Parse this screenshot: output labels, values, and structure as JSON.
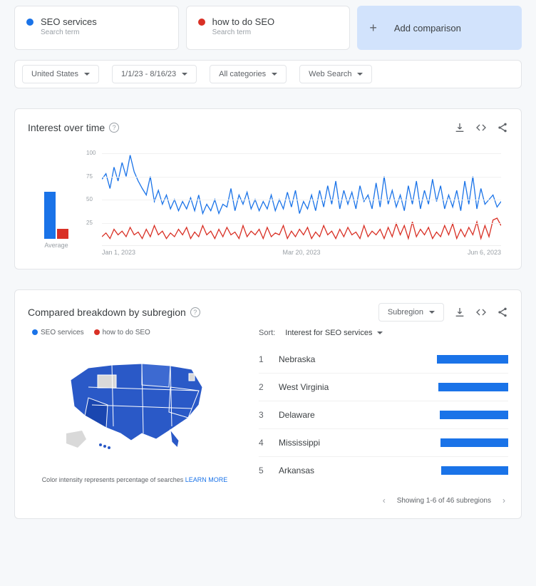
{
  "terms": [
    {
      "name": "SEO services",
      "subtitle": "Search term",
      "color": "#1a73e8"
    },
    {
      "name": "how to do SEO",
      "subtitle": "Search term",
      "color": "#d93025"
    }
  ],
  "add_comparison_label": "Add comparison",
  "filters": {
    "geo": "United States",
    "date": "1/1/23 - 8/16/23",
    "category": "All categories",
    "search_type": "Web Search"
  },
  "interest_card": {
    "title": "Interest over time",
    "avg_label": "Average",
    "x_labels": [
      "Jan 1, 2023",
      "Mar 20, 2023",
      "Jun 6, 2023"
    ]
  },
  "chart_data": {
    "type": "line",
    "title": "Interest over time",
    "xlabel": "",
    "ylabel": "",
    "ylim": [
      0,
      100
    ],
    "yticks": [
      25,
      50,
      75,
      100
    ],
    "x_labels": [
      "Jan 1, 2023",
      "Mar 20, 2023",
      "Jun 6, 2023"
    ],
    "series": [
      {
        "name": "SEO services",
        "color": "#1a73e8",
        "avg": 55,
        "values": [
          72,
          78,
          62,
          85,
          70,
          90,
          75,
          98,
          80,
          70,
          62,
          55,
          75,
          48,
          60,
          45,
          55,
          40,
          50,
          38,
          48,
          40,
          52,
          38,
          55,
          35,
          45,
          38,
          50,
          35,
          45,
          42,
          62,
          38,
          55,
          45,
          58,
          40,
          50,
          38,
          48,
          40,
          55,
          38,
          50,
          40,
          58,
          42,
          60,
          35,
          48,
          40,
          55,
          38,
          60,
          42,
          65,
          45,
          70,
          40,
          60,
          45,
          58,
          40,
          65,
          48,
          55,
          40,
          68,
          42,
          75,
          45,
          60,
          42,
          55,
          38,
          65,
          45,
          70,
          40,
          60,
          45,
          72,
          48,
          65,
          40,
          55,
          42,
          60,
          38,
          70,
          45,
          75,
          40,
          62,
          45,
          50,
          55,
          42,
          48
        ]
      },
      {
        "name": "how to do SEO",
        "color": "#d93025",
        "avg": 12,
        "values": [
          10,
          14,
          8,
          18,
          12,
          16,
          10,
          20,
          12,
          15,
          8,
          18,
          10,
          22,
          12,
          16,
          8,
          14,
          10,
          18,
          12,
          20,
          8,
          15,
          10,
          22,
          12,
          16,
          8,
          18,
          10,
          20,
          12,
          15,
          8,
          22,
          10,
          16,
          12,
          18,
          8,
          20,
          10,
          14,
          12,
          22,
          8,
          16,
          10,
          18,
          12,
          20,
          8,
          15,
          10,
          22,
          12,
          16,
          8,
          18,
          10,
          20,
          12,
          15,
          8,
          22,
          10,
          16,
          12,
          18,
          8,
          20,
          10,
          24,
          12,
          22,
          8,
          26,
          10,
          18,
          12,
          20,
          8,
          15,
          10,
          22,
          12,
          24,
          8,
          18,
          10,
          20,
          12,
          26,
          8,
          22,
          10,
          28,
          30,
          22
        ]
      }
    ]
  },
  "region_card": {
    "title": "Compared breakdown by subregion",
    "dropdown_label": "Subregion",
    "legend": [
      "SEO services",
      "how to do SEO"
    ],
    "sort_label": "Sort:",
    "sort_value": "Interest for SEO services",
    "map_note_text": "Color intensity represents percentage of searches ",
    "map_note_link": "LEARN MORE",
    "pagination": "Showing 1-6 of 46 subregions",
    "rows": [
      {
        "rank": 1,
        "name": "Nebraska",
        "bar": 100
      },
      {
        "rank": 2,
        "name": "West Virginia",
        "bar": 98
      },
      {
        "rank": 3,
        "name": "Delaware",
        "bar": 96
      },
      {
        "rank": 4,
        "name": "Mississippi",
        "bar": 95
      },
      {
        "rank": 5,
        "name": "Arkansas",
        "bar": 94
      }
    ]
  }
}
